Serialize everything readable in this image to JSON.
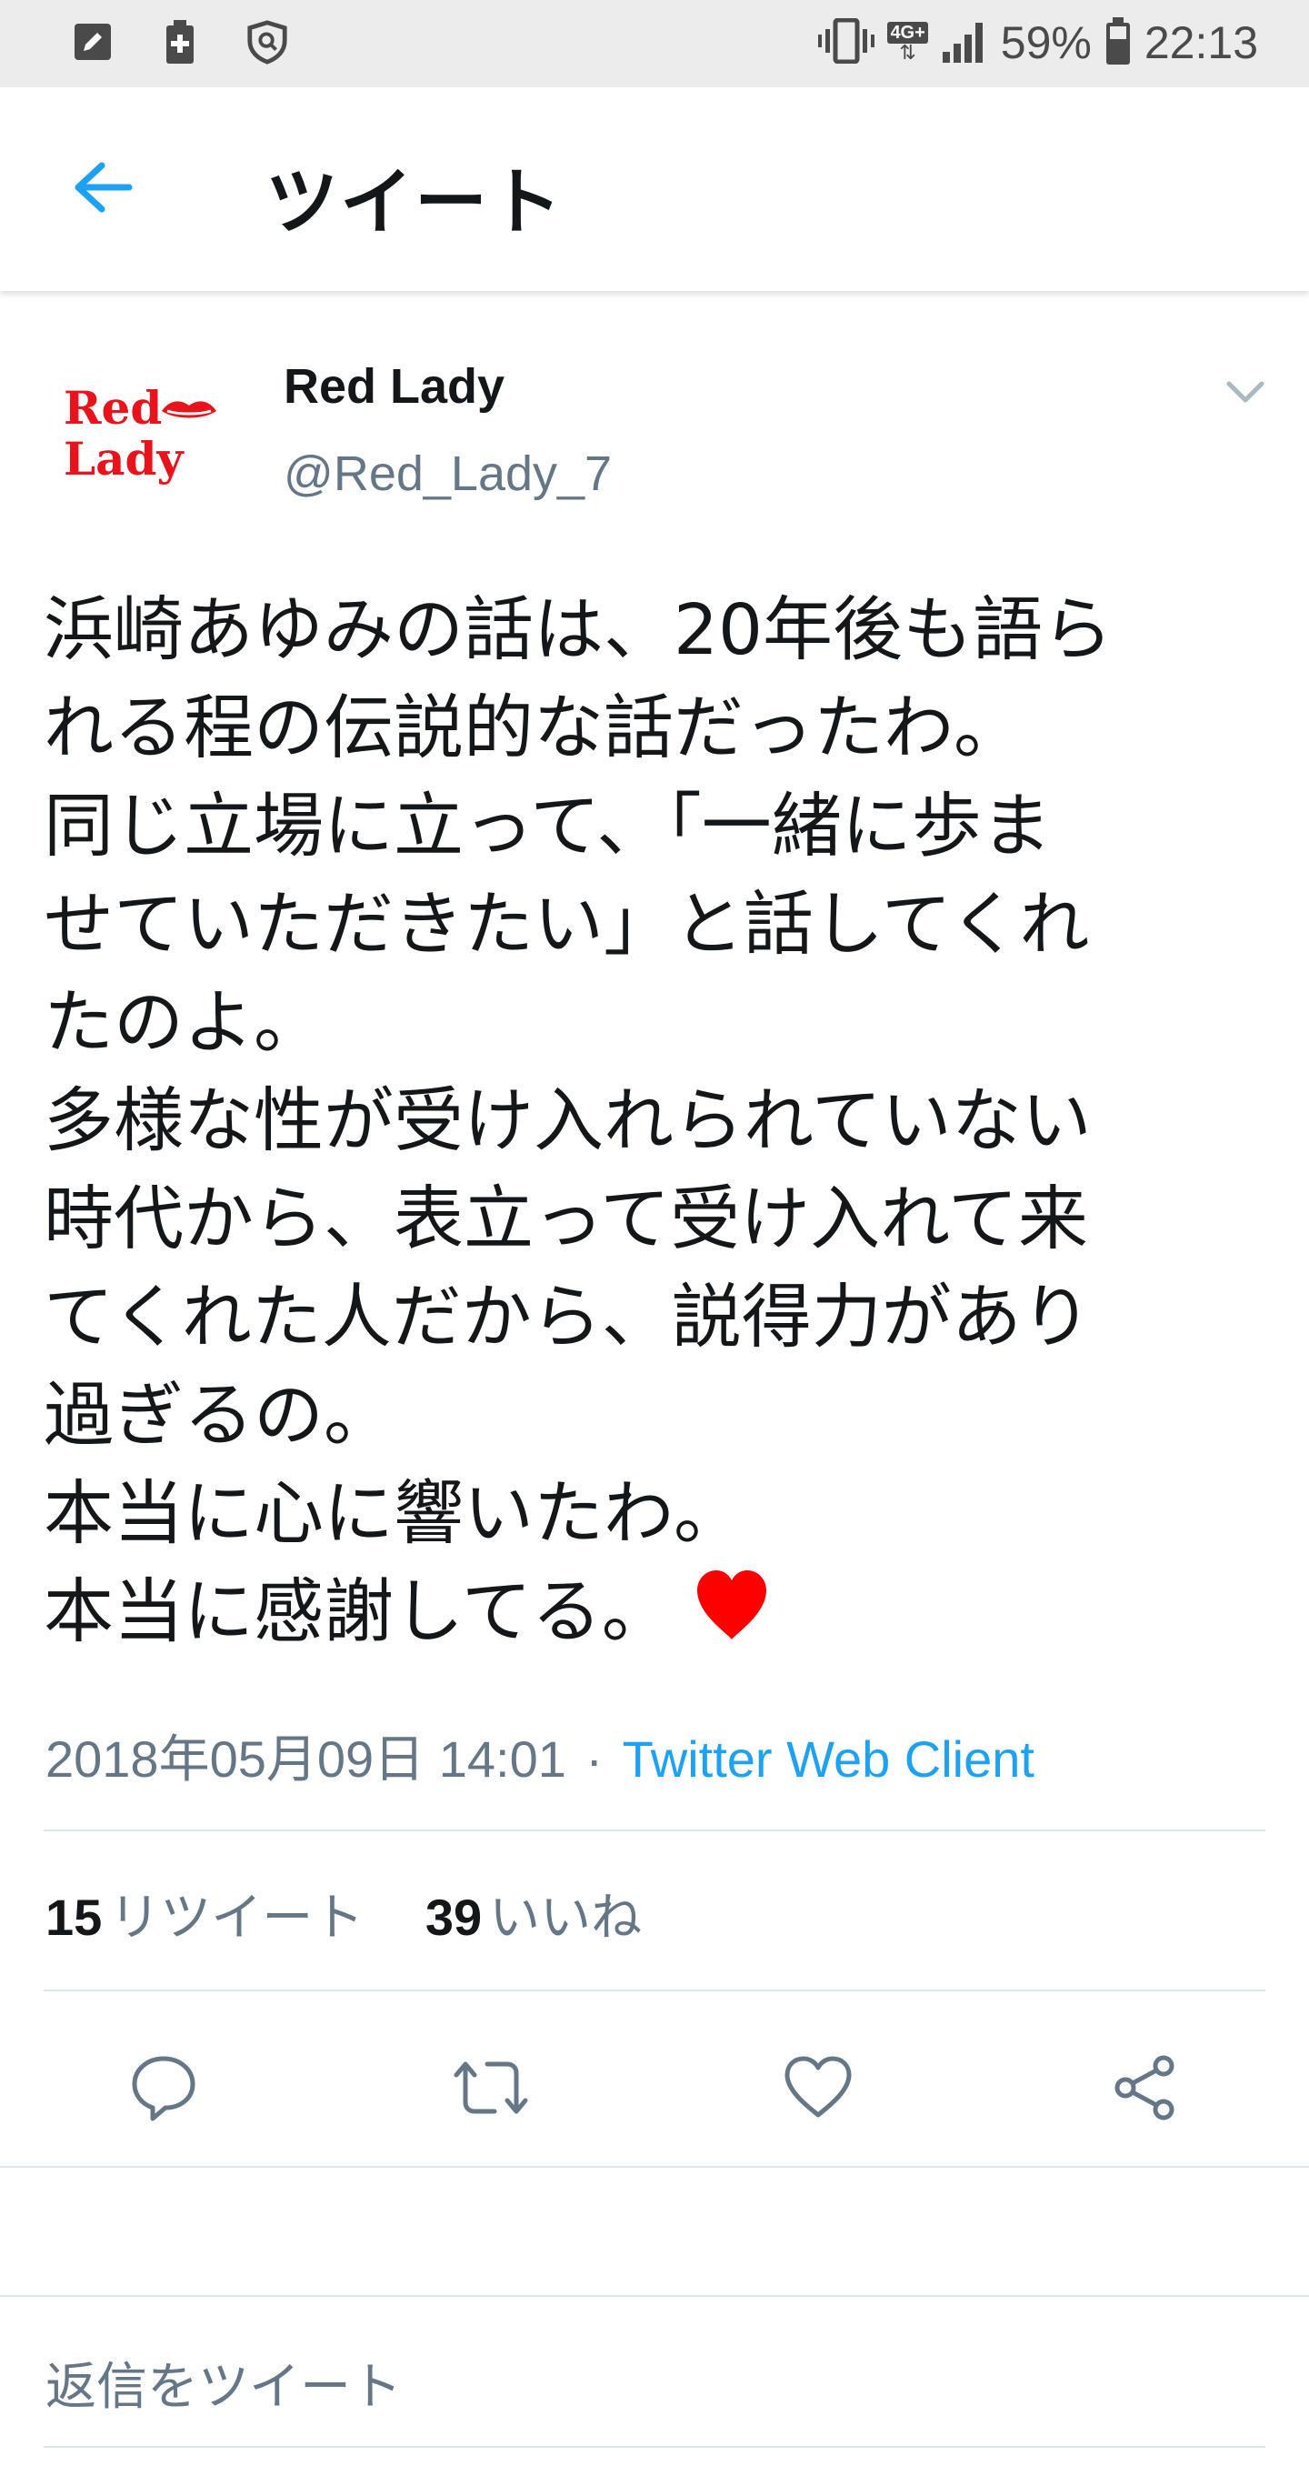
{
  "status_bar": {
    "battery": "59%",
    "time": "22:13",
    "network": "4G+",
    "icons": [
      "edit-icon",
      "battery-saver-icon",
      "shield-icon",
      "vibrate-icon",
      "signal-icon",
      "battery-icon"
    ]
  },
  "app_bar": {
    "title": "ツイート",
    "back_icon": "arrow-left-icon"
  },
  "tweet": {
    "author_name": "Red Lady",
    "author_handle": "@Red_Lady_7",
    "avatar_line1": "Red",
    "avatar_line2": "Lady",
    "text": "浜崎あゆみの話は、20年後も語ら\nれる程の伝説的な話だったわ。\n同じ立場に立って、「一緒に歩ま\nせていただきたい」と話してくれ\nたのよ。\n多様な性が受け入れられていない\n時代から、表立って受け入れて来\nてくれた人だから、説得力があり\n過ぎるの。\n本当に心に響いたわ。\n本当に感謝してる。",
    "emoji": "heart-icon",
    "timestamp": "2018年05月09日 14:01",
    "separator": "·",
    "client": "Twitter Web Client",
    "retweet_count": "15",
    "retweet_label": "リツイート",
    "like_count": "39",
    "like_label": "いいね"
  },
  "actions": [
    "reply-icon",
    "retweet-icon",
    "like-icon",
    "share-icon"
  ],
  "reply": {
    "placeholder": "返信をツイート"
  },
  "colors": {
    "accent": "#1da1f2",
    "secondary_text": "#657786",
    "heart": "#ff0000",
    "avatar_red": "#e8131b"
  }
}
